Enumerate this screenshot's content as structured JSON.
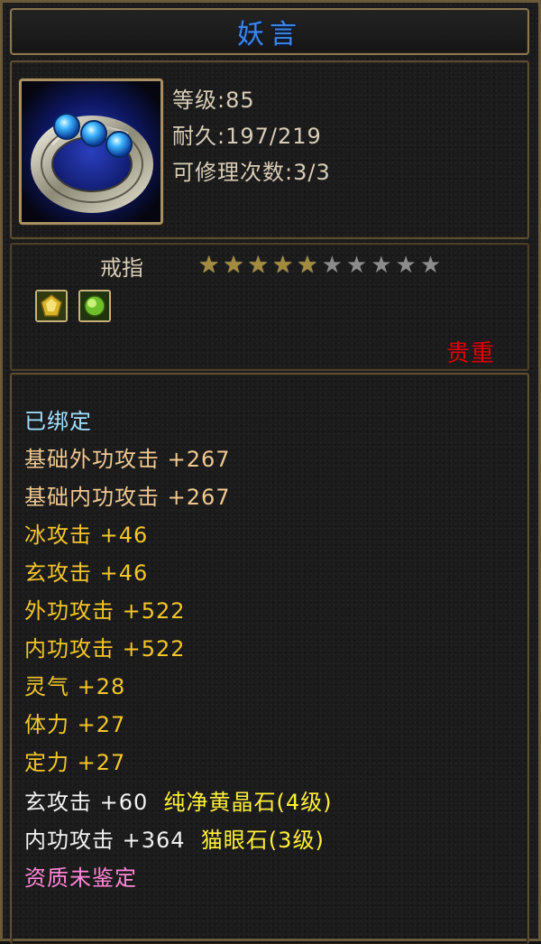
{
  "item": {
    "name": "妖言",
    "level_line": "等级:85",
    "durability_line": "耐久:197/219",
    "repair_line": "可修理次数:3/3",
    "type": "戒指",
    "stars_filled": 5,
    "stars_total": 10,
    "rarity": "贵重",
    "icon": "ring-icon",
    "gem_slots": [
      "yellow-gem-icon",
      "green-gem-icon"
    ]
  },
  "attributes": {
    "bound": "已绑定",
    "base": [
      "基础外功攻击 +267",
      "基础内功攻击 +267"
    ],
    "bonus": [
      "冰攻击 +46",
      "玄攻击 +46",
      "外功攻击 +522",
      "内功攻击 +522",
      "灵气 +28",
      "体力 +27",
      "定力 +27"
    ],
    "gems": [
      {
        "stat": "玄攻击 +60",
        "name": "纯净黄晶石(4级)"
      },
      {
        "stat": "内功攻击 +364",
        "name": "猫眼石(3级)"
      }
    ],
    "quality": "资质未鉴定"
  },
  "colors": {
    "title": "#3d86e6",
    "rarity": "#e00000",
    "bound": "#9fe0ff",
    "base": "#f0c890",
    "bonus": "#f3c52a",
    "gem_name": "#ffef3a",
    "quality": "#ff86d8"
  }
}
